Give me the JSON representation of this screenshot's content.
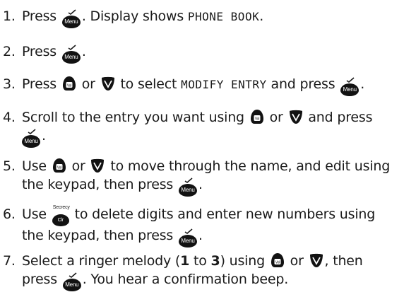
{
  "icons": {
    "menu_key": "menu-key-icon",
    "up_key": "vol-up-key-icon",
    "down_key": "down-key-icon",
    "clear_key": "clear-key-icon"
  },
  "keys": {
    "menu_label": "Menu",
    "vol_label": "Vol",
    "clr_label": "Clr",
    "secrecy_label": "Secrecy"
  },
  "steps": [
    {
      "num": "1.",
      "t1": "Press",
      "t2": ". Display shows",
      "lcd": "PHONE BOOK",
      "t3": "."
    },
    {
      "num": "2.",
      "t1": "Press",
      "t2": "."
    },
    {
      "num": "3.",
      "t1": "Press",
      "t2": "or",
      "t3": "to select",
      "lcd": "MODIFY ENTRY",
      "t4": "and press",
      "t5": "."
    },
    {
      "num": "4.",
      "t1": "Scroll to the entry you want using",
      "t2": "or",
      "t3": "and press",
      "t4": "."
    },
    {
      "num": "5.",
      "t1": "Use",
      "t2": "or",
      "t3": "to move through the name, and edit using",
      "t4": "the keypad, then press",
      "t5": "."
    },
    {
      "num": "6.",
      "t1": "Use",
      "t2": "to delete digits and enter new numbers using",
      "t3": "the keypad, then press",
      "t4": "."
    },
    {
      "num": "7.",
      "t1": "Select a ringer melody (",
      "b1": "1",
      "t2": "to",
      "b2": "3",
      "t3": ") using",
      "t4": "or",
      "t5": ", then",
      "t6": "press",
      "t7": ". You hear a confirmation beep."
    }
  ]
}
